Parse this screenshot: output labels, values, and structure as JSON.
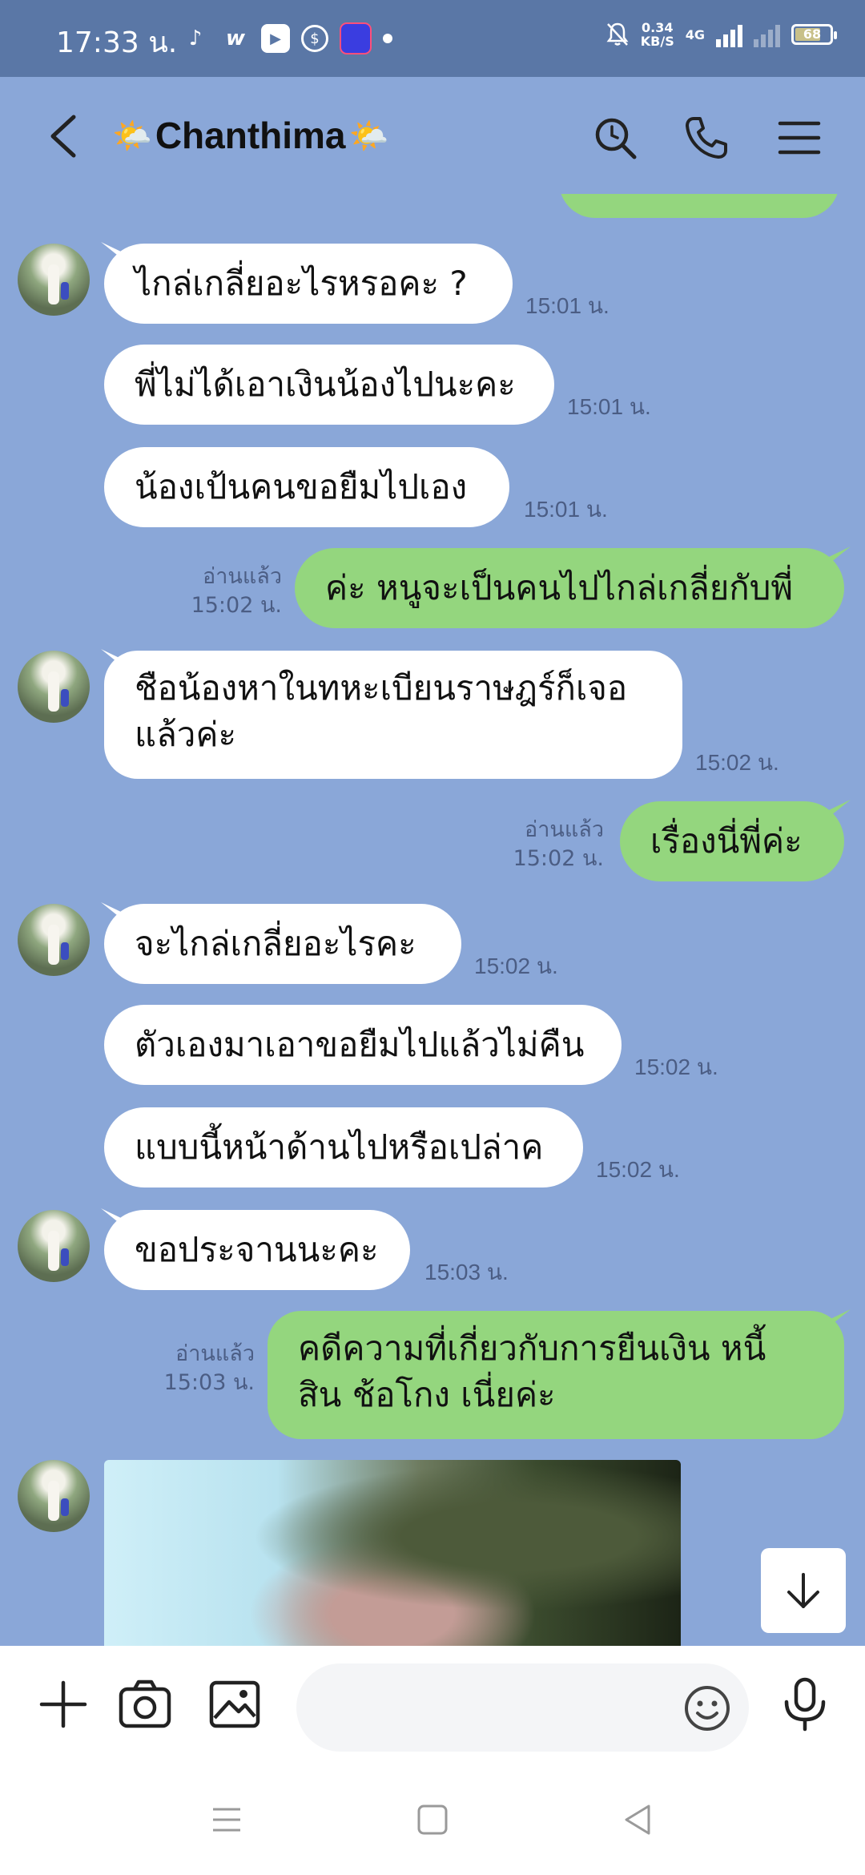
{
  "status_bar": {
    "time": "17:33 น.",
    "net_speed_value": "0.34",
    "net_speed_unit": "KB/S",
    "network": "4G",
    "battery": "68",
    "battery_level": 0.68
  },
  "header": {
    "contact_name": "Chanthima",
    "name_emoji": "🌤️"
  },
  "chat": {
    "messages": [
      {
        "side": "in",
        "text": "ไกล่เกลี่ยอะไรหรอคะ ?",
        "time": "15:01 น.",
        "avatar": true
      },
      {
        "side": "in",
        "text": "พี่ไม่ได้เอาเงินน้องไปนะคะ",
        "time": "15:01 น."
      },
      {
        "side": "in",
        "text": "น้องเป้นคนขอยืมไปเอง",
        "time": "15:01 น."
      },
      {
        "side": "out",
        "text": "ค่ะ หนูจะเป็นคนไปไกล่เกลี่ยกับพี่",
        "time": "15:02 น.",
        "read": "อ่านแล้ว"
      },
      {
        "side": "in",
        "line1": "ชือน้องหาในทหะเบียนราษฎร์ก็เจอ",
        "line2": "แล้วค่ะ",
        "time": "15:02 น.",
        "avatar": true
      },
      {
        "side": "out",
        "text": "เรื่องนี่พี่ค่ะ",
        "time": "15:02 น.",
        "read": "อ่านแล้ว"
      },
      {
        "side": "in",
        "text": "จะไกล่เกลี่ยอะไรคะ",
        "time": "15:02 น.",
        "avatar": true
      },
      {
        "side": "in",
        "text": "ตัวเองมาเอาขอยืมไปแล้วไม่คืน",
        "time": "15:02 น."
      },
      {
        "side": "in",
        "text": "แบบนี้หน้าด้านไปหรือเปล่าค",
        "time": "15:02 น."
      },
      {
        "side": "in",
        "text": "ขอประจานนะคะ",
        "time": "15:03 น.",
        "avatar": true
      },
      {
        "side": "out",
        "line1": "คดีความที่เกี่ยวกับการยืนเงิน หนี้",
        "line2": "สิน ช้อโกง เนี่ยค่ะ",
        "time": "15:03 น.",
        "read": "อ่านแล้ว"
      },
      {
        "side": "in",
        "type": "image",
        "avatar": true
      }
    ]
  },
  "input": {
    "placeholder": ""
  },
  "icons": {
    "back": "back-arrow-icon",
    "search": "search-icon",
    "call": "phone-icon",
    "menu": "hamburger-menu-icon",
    "add": "plus-icon",
    "camera": "camera-icon",
    "image": "image-icon",
    "emoji": "emoji-icon",
    "mic": "microphone-icon",
    "scroll_down": "arrow-down-icon"
  },
  "colors": {
    "status_bar": "#5a77a6",
    "chat_background": "#8aa7d8",
    "incoming_bubble": "#ffffff",
    "outgoing_bubble": "#94d67e"
  }
}
